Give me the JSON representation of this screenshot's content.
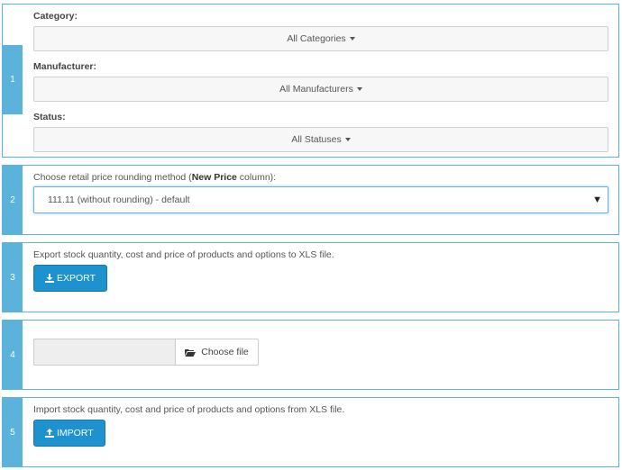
{
  "filters": {
    "step": "1",
    "category": {
      "label": "Category:",
      "value": "All Categories"
    },
    "manufacturer": {
      "label": "Manufacturer:",
      "value": "All Manufacturers"
    },
    "status": {
      "label": "Status:",
      "value": "All Statuses"
    }
  },
  "rounding": {
    "step": "2",
    "label_prefix": "Choose retail price rounding method (",
    "label_bold": "New Price",
    "label_suffix": " column):",
    "selected": "111.11 (without rounding) - default"
  },
  "export": {
    "step": "3",
    "description": "Export stock quantity, cost and price of products and options to XLS file.",
    "button": "EXPORT",
    "icon": "download-icon"
  },
  "file": {
    "step": "4",
    "button": "Choose file",
    "icon": "folder-open-icon"
  },
  "import": {
    "step": "5",
    "description": "Import stock quantity, cost and price of products and options from XLS file.",
    "button": "IMPORT",
    "icon": "upload-icon"
  },
  "colors": {
    "accent": "#5bb2da",
    "button": "#1e91cf"
  }
}
